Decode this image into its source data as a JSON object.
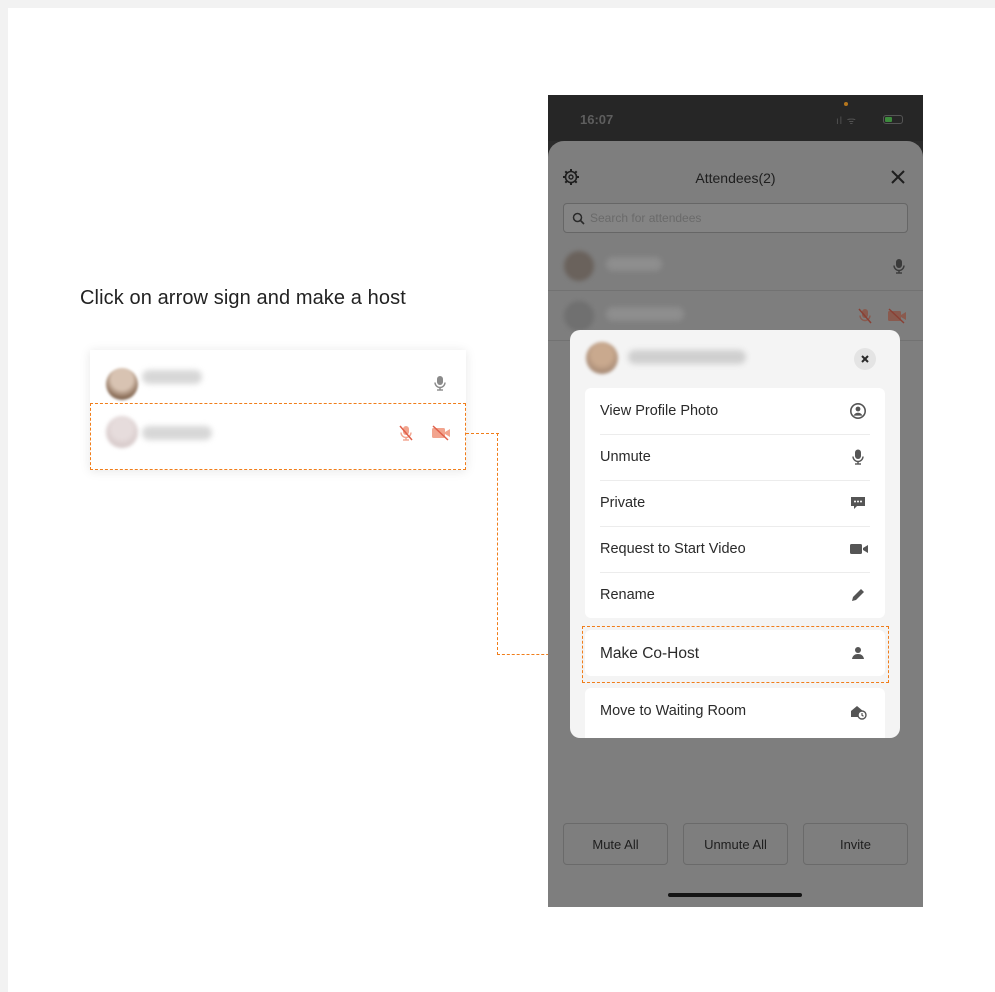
{
  "caption": "Click on arrow sign and make a host",
  "phone": {
    "status_time": "16:07",
    "status_signal": "ıl ᯤ",
    "sheet_title": "Attendees(2)",
    "search_placeholder": "Search for attendees",
    "bottom_buttons": {
      "mute_all": "Mute All",
      "unmute_all": "Unmute All",
      "invite": "Invite"
    }
  },
  "popup_menu": {
    "items": [
      {
        "label": "View Profile Photo",
        "icon": "profile-icon"
      },
      {
        "label": "Unmute",
        "icon": "microphone-icon"
      },
      {
        "label": "Private",
        "icon": "chat-icon"
      },
      {
        "label": "Request to Start Video",
        "icon": "video-camera-icon"
      },
      {
        "label": "Rename",
        "icon": "pencil-icon"
      }
    ],
    "cohost": {
      "label": "Make Co-Host",
      "icon": "person-icon"
    },
    "waiting": {
      "label": "Move to Waiting Room",
      "icon": "waiting-room-icon"
    }
  },
  "colors": {
    "highlight": "#f07d1a",
    "overlay": "#7e7e7e"
  }
}
